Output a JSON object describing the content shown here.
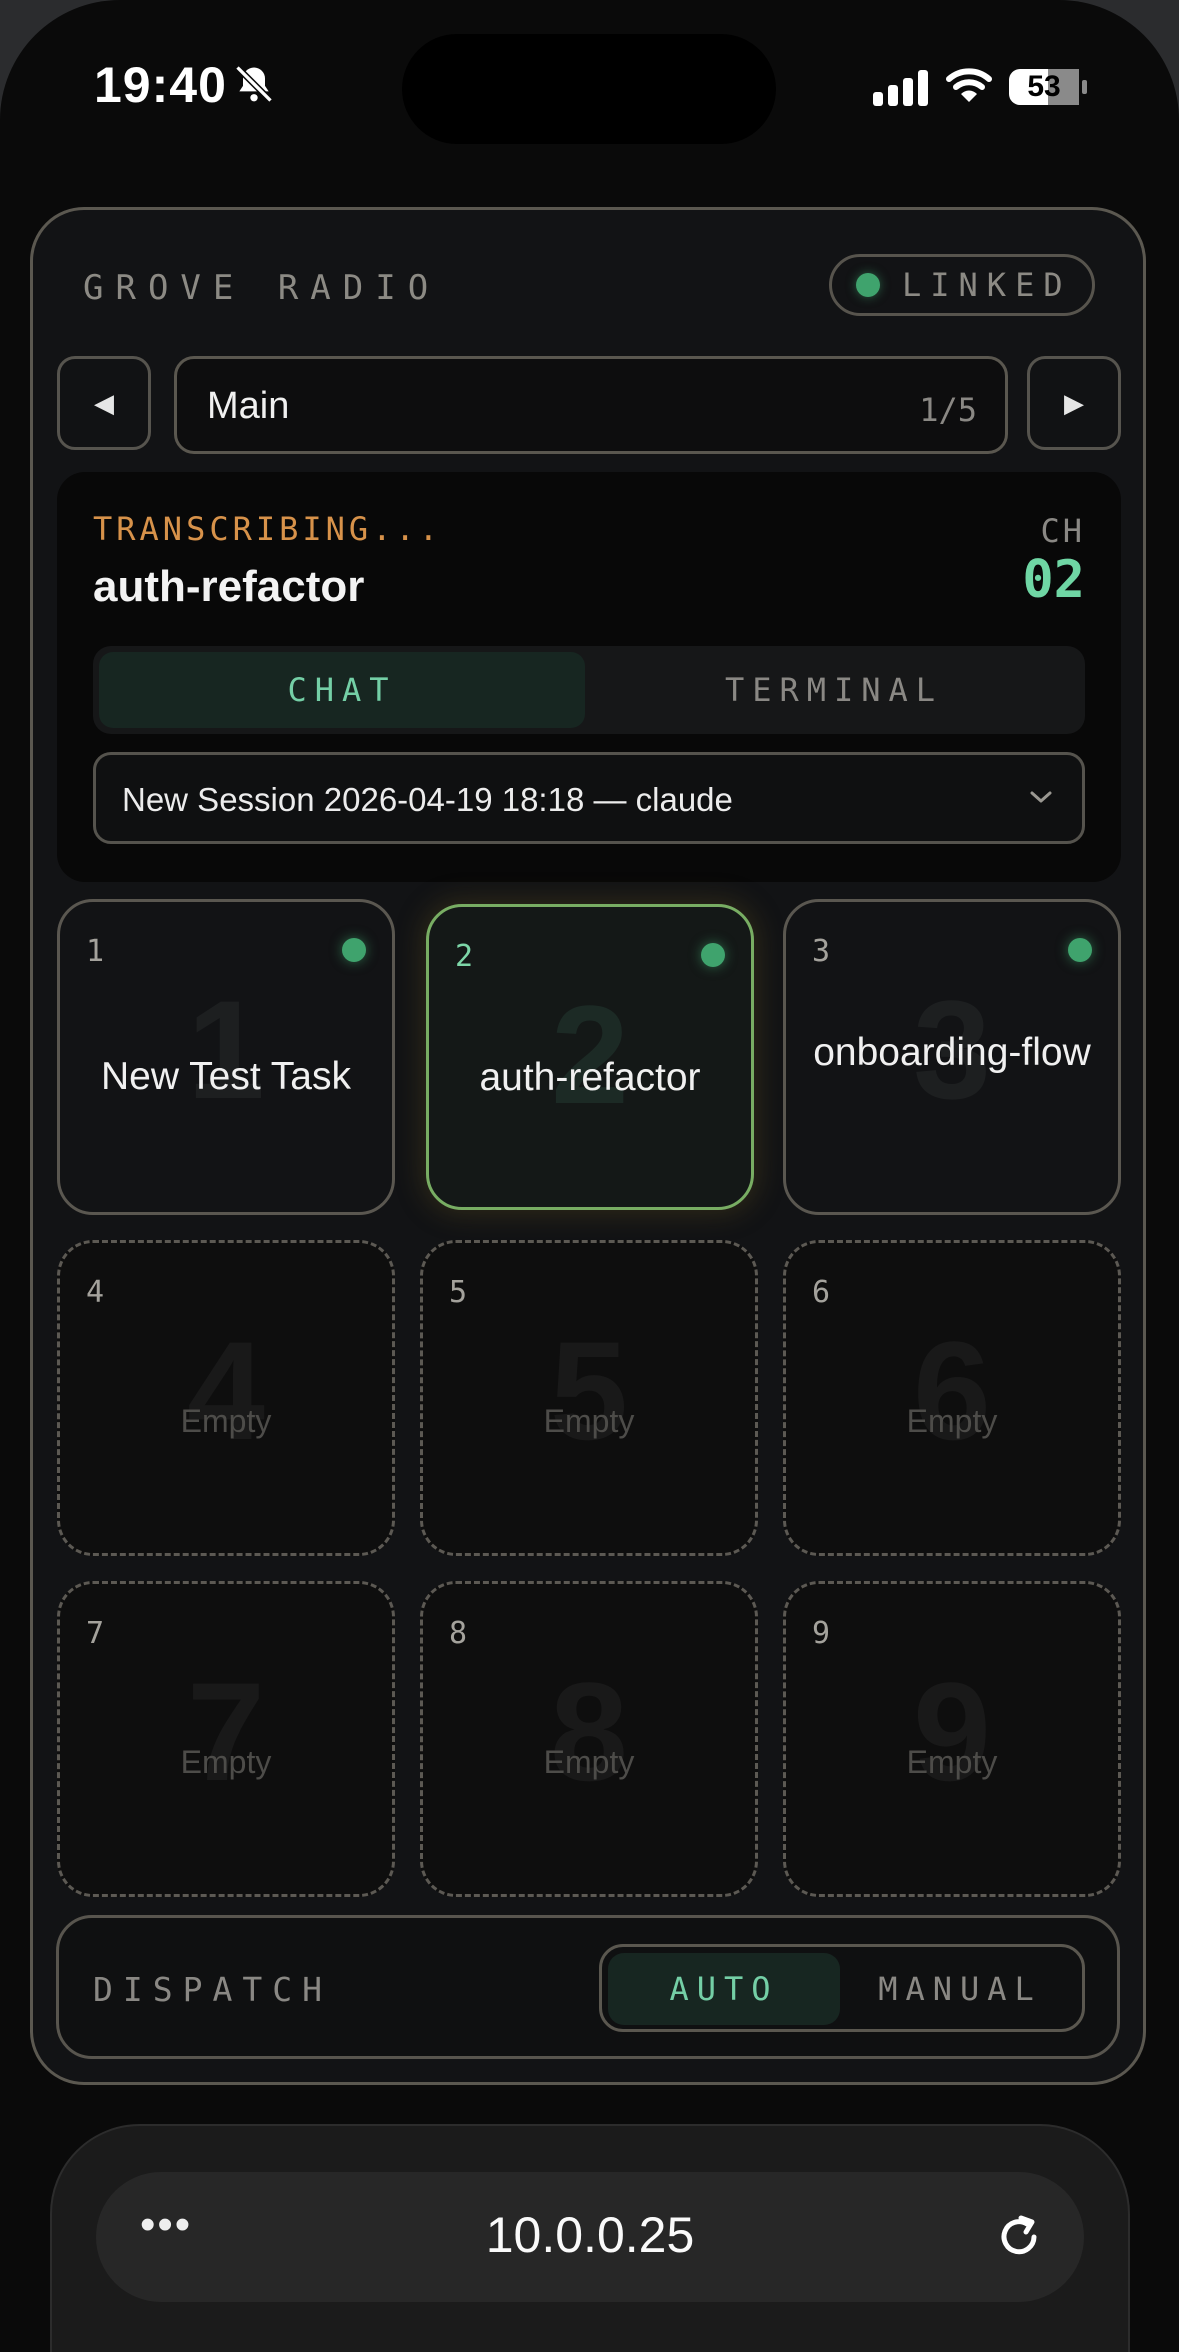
{
  "status_bar": {
    "time": "19:40",
    "battery": "53"
  },
  "app": {
    "title": "GROVE RADIO",
    "link_status": "LINKED"
  },
  "nav": {
    "prev": "◀",
    "next": "▶",
    "page_name": "Main",
    "page_counter": "1/5"
  },
  "session": {
    "state": "TRANSCRIBING...",
    "task_name": "auth-refactor",
    "channel_label": "CH",
    "channel_number": "02",
    "tabs": [
      {
        "label": "CHAT",
        "active": true
      },
      {
        "label": "TERMINAL",
        "active": false
      }
    ],
    "selected_session": "New Session 2026-04-19 18:18 — claude"
  },
  "slots": [
    {
      "num": "1",
      "big": "1",
      "label": "New Test Task",
      "status": "filled"
    },
    {
      "num": "2",
      "big": "2",
      "label": "auth-refactor",
      "status": "active"
    },
    {
      "num": "3",
      "big": "3",
      "label": "onboarding-flow",
      "status": "filled"
    },
    {
      "num": "4",
      "big": "4",
      "label": "Empty",
      "status": "empty"
    },
    {
      "num": "5",
      "big": "5",
      "label": "Empty",
      "status": "empty"
    },
    {
      "num": "6",
      "big": "6",
      "label": "Empty",
      "status": "empty"
    },
    {
      "num": "7",
      "big": "7",
      "label": "Empty",
      "status": "empty"
    },
    {
      "num": "8",
      "big": "8",
      "label": "Empty",
      "status": "empty"
    },
    {
      "num": "9",
      "big": "9",
      "label": "Empty",
      "status": "empty"
    }
  ],
  "dispatch": {
    "label": "DISPATCH",
    "modes": [
      {
        "label": "AUTO",
        "active": true
      },
      {
        "label": "MANUAL",
        "active": false
      }
    ]
  },
  "browser": {
    "more": "•••",
    "url": "10.0.0.25"
  },
  "colors": {
    "accent": "#6fd6a4",
    "status_dot": "#3fa36d",
    "warning": "#d7924a",
    "active_border": "#78ad63"
  }
}
